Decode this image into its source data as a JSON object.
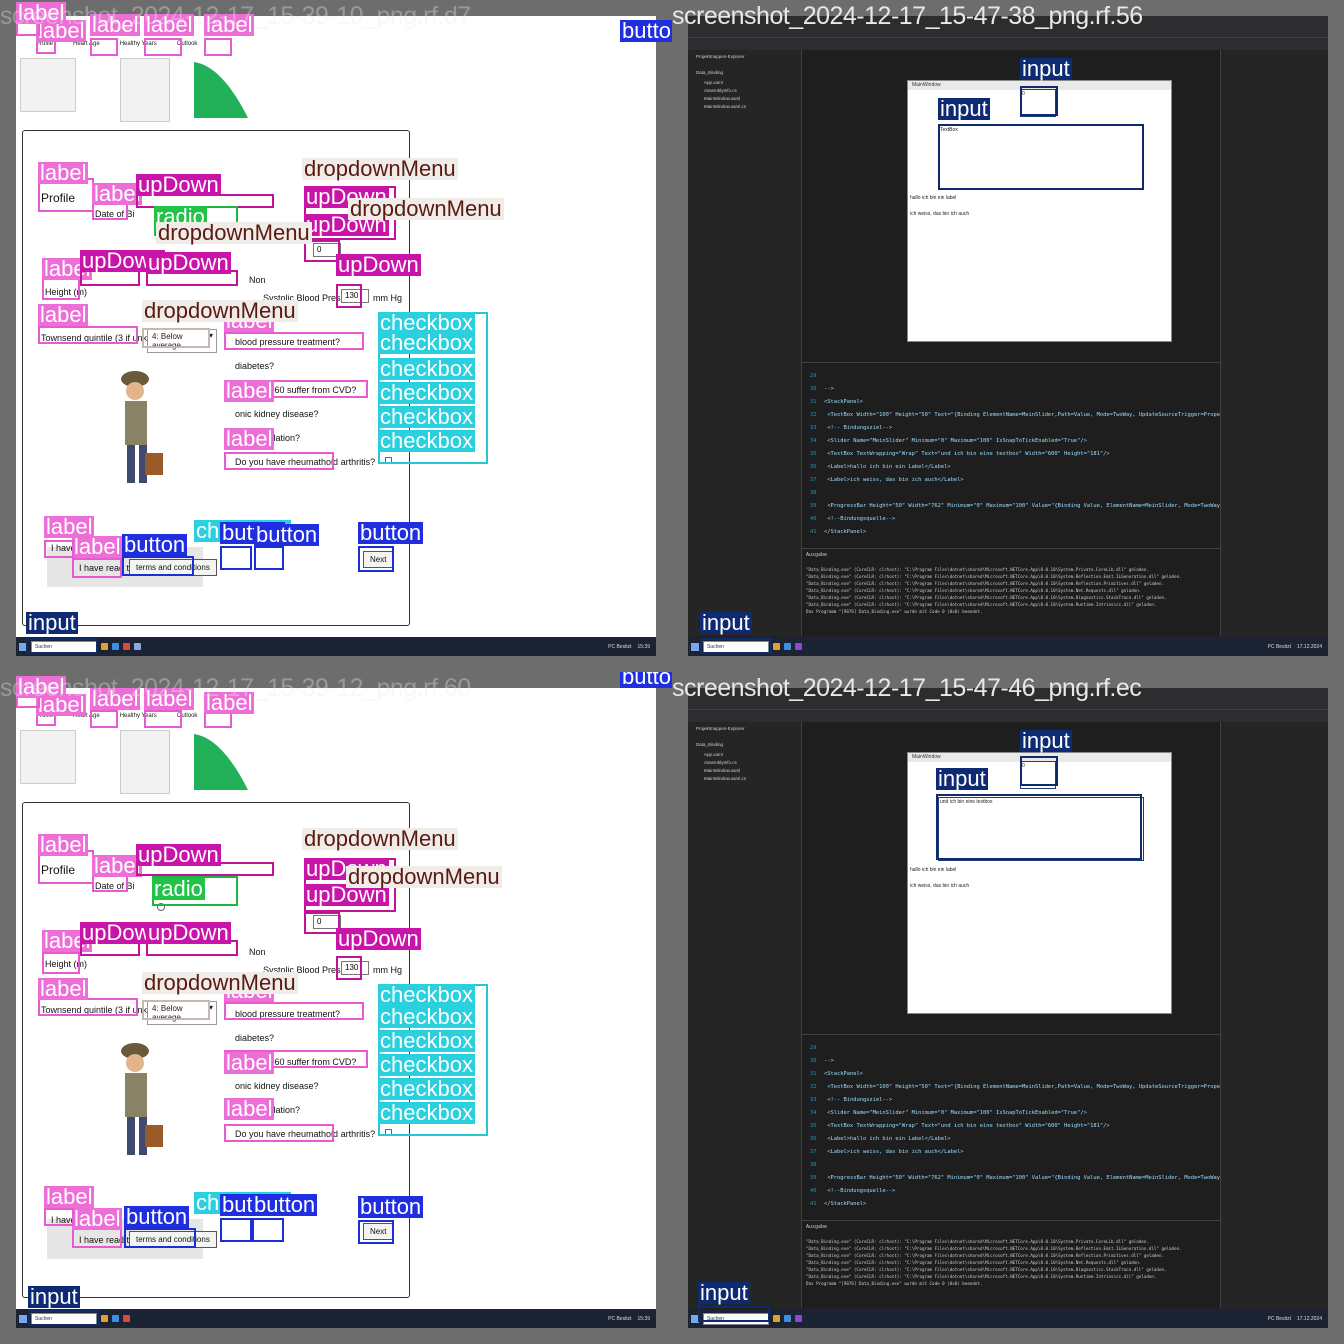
{
  "tiles": {
    "t1": {
      "filename": "screenshot_2024-12-17_15-39-10_png.rf.d7"
    },
    "t2": {
      "filename": "screenshot_2024-12-17_15-47-38_png.rf.56"
    },
    "t3": {
      "filename": "screenshot_2024-12-17_15-39-12_png.rf.60"
    },
    "t4": {
      "filename": "screenshot_2024-12-17_15-47-46_png.rf.ec"
    }
  },
  "web": {
    "tabs": [
      "Profile",
      "Heart Age",
      "Healthy Years",
      "Outlook"
    ],
    "form": {
      "profile_heading": "Profile",
      "date_of_birth_label": "Date of Bi",
      "height_label": "Height (m)",
      "non_label": "Non",
      "systolic_label": "Systolic Blood Pressure:",
      "systolic_value": "130",
      "systolic_unit": "mm Hg",
      "zero_value": "0",
      "townsend_label": "Townsend quintile (3 if unknown)",
      "townsend_select": "4: Below average",
      "q_bp_treatment": "blood pressure treatment?",
      "q_diabetes": "diabetes?",
      "q_cvd": "ive under 60 suffer from CVD?",
      "q_kidney": "onic kidney disease?",
      "q_af": "atrial fibrillation?",
      "q_ra": "Do you have rheumathoid arthritis?",
      "have_read_label": "I have read the",
      "terms_button": "terms and conditions",
      "next_button": "Next",
      "have_ne_text": "I have ne"
    }
  },
  "taskbar": {
    "search": "Suchen",
    "weather": "PC Besitzt",
    "time": "15:39",
    "date": "17.12.2024"
  },
  "ide": {
    "solution_title": "Projektmappen-Explorer",
    "project": "Data_Binding",
    "files": [
      "App.xaml",
      "AssemblyInfo.cs",
      "MainWindow.xaml",
      "MainWindow.xaml.cs"
    ],
    "window_title": "MainWindow",
    "textbox_text_t2": "TextBox",
    "textbox_text_t4": "und ich bin eine textbox",
    "label1": "hallo ich bin ein label",
    "label2": "ich weiss, das bin ich auch",
    "code_lines": [
      {
        "n": "29",
        "t": ""
      },
      {
        "n": "30",
        "t": "-->"
      },
      {
        "n": "31",
        "t": "<StackPanel>"
      },
      {
        "n": "32",
        "t": "  <TextBox Width=\"100\" Height=\"50\" Text=\"{Binding ElementName=MeinSlider,Path=Value, Mode=TwoWay, UpdateSourceTrigger=PropertyCha"
      },
      {
        "n": "33",
        "t": "  <!-- Bindungsziel-->"
      },
      {
        "n": "34",
        "t": "  <Slider Name=\"MeinSlider\" Minimum=\"0\" Maximum=\"100\" IsSnapToTickEnabled=\"True\"/>"
      },
      {
        "n": "35",
        "t": "  <TextBox TextWrapping=\"Wrap\" Text=\"und ich bin eine textbox\" Width=\"600\" Height=\"181\"/>"
      },
      {
        "n": "36",
        "t": "  <Label>hallo ich bin ein Label</Label>"
      },
      {
        "n": "37",
        "t": "  <Label>ich weiss, das bin ich auch</Label>"
      },
      {
        "n": "38",
        "t": ""
      },
      {
        "n": "39",
        "t": "  <ProgressBar Height=\"50\" Width=\"762\" Minimum=\"0\" Maximum=\"100\" Value=\"{Binding Value, ElementName=MeinSlider, Mode=TwoWay, Upda"
      },
      {
        "n": "40",
        "t": "  <!--Bindungsquelle-->"
      },
      {
        "n": "41",
        "t": "</StackPanel>"
      }
    ],
    "output_header": "Ausgabe",
    "output_lines": [
      "\"Data_Binding.exe\" (CoreCLR: clrhost): \"C:\\Program Files\\dotnet\\shared\\Microsoft.NETCore.App\\8.0.10\\System.Private.CoreLib.dll\" geladen.",
      "\"Data_Binding.exe\" (CoreCLR: clrhost): \"C:\\Program Files\\dotnet\\shared\\Microsoft.NETCore.App\\8.0.10\\System.Reflection.Emit.ILGeneration.dll\" geladen.",
      "\"Data_Binding.exe\" (CoreCLR: clrhost): \"C:\\Program Files\\dotnet\\shared\\Microsoft.NETCore.App\\8.0.10\\System.Reflection.Primitives.dll\" geladen.",
      "\"Data_Binding.exe\" (CoreCLR: clrhost): \"C:\\Program Files\\dotnet\\shared\\Microsoft.NETCore.App\\8.0.10\\System.Net.Requests.dll\" geladen.",
      "\"Data_Binding.exe\" (CoreCLR: clrhost): \"C:\\Program Files\\dotnet\\shared\\Microsoft.NETCore.App\\8.0.10\\System.Diagnostics.StackTrace.dll\" geladen.",
      "\"Data_Binding.exe\" (CoreCLR: clrhost): \"C:\\Program Files\\dotnet\\shared\\Microsoft.NETCore.App\\8.0.10\\System.Runtime.Intrinsics.dll\" geladen.",
      "Das Programm \"[9076] Data_Binding.exe\" wurde mit Code 0 (0x0) beendet."
    ]
  },
  "annotations": {
    "label": "label",
    "dropdownMenu": "dropdownMenu",
    "upDown": "upDown",
    "radio": "radio",
    "checkbox": "checkbox",
    "button": "button",
    "input": "input"
  },
  "colors": {
    "label": "#ee6ed7",
    "upDown": "#c814a8",
    "checkbox": "#2bd0de",
    "button": "#1f2fe0",
    "input": "#0d2a72",
    "radio": "#22c448"
  }
}
